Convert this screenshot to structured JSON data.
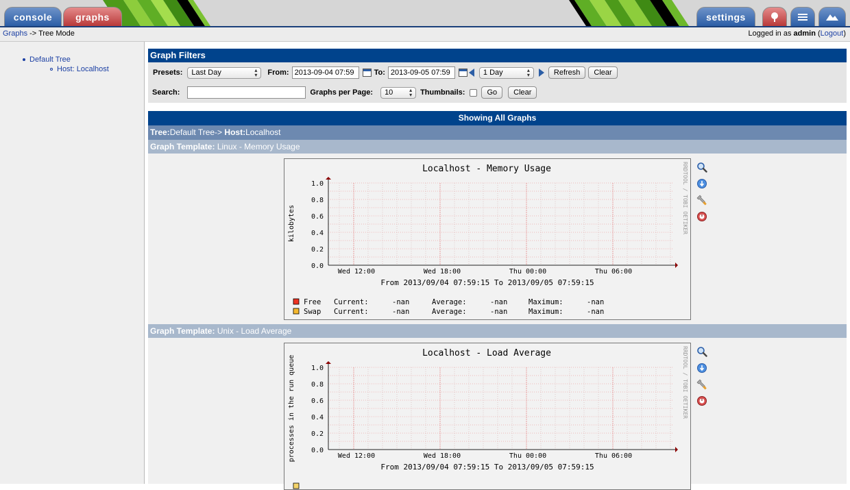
{
  "nav": {
    "console_label": "console",
    "graphs_label": "graphs",
    "settings_label": "settings"
  },
  "breadcrumb": {
    "graphs_link": "Graphs",
    "rest": " -> Tree Mode"
  },
  "login": {
    "prefix": "Logged in as ",
    "user": "admin",
    "logout": "Logout"
  },
  "tree": {
    "root": "Default Tree",
    "host": "Host: Localhost"
  },
  "filters": {
    "title": "Graph Filters",
    "presets_label": "Presets:",
    "presets_value": "Last Day",
    "from_label": "From:",
    "from_value": "2013-09-04 07:59",
    "to_label": "To:",
    "to_value": "2013-09-05 07:59",
    "timespan_value": "1 Day",
    "refresh_label": "Refresh",
    "clear_label": "Clear",
    "search_label": "Search:",
    "search_value": "",
    "per_page_label": "Graphs per Page:",
    "per_page_value": "10",
    "thumbnails_label": "Thumbnails:",
    "go_label": "Go",
    "clear2_label": "Clear"
  },
  "showing": "Showing All Graphs",
  "tree_header": {
    "tree_label": "Tree:",
    "tree_value": "Default Tree->",
    "host_label": "Host:",
    "host_value": "Localhost"
  },
  "graphs": [
    {
      "template_label": "Graph Template:",
      "template_value": "Linux - Memory Usage",
      "title": "Localhost - Memory Usage",
      "ylabel": "kilobytes",
      "yticks": [
        "1.0",
        "0.8",
        "0.6",
        "0.4",
        "0.2",
        "0.0"
      ],
      "xticks": [
        "Wed 12:00",
        "Wed 18:00",
        "Thu 00:00",
        "Thu 06:00"
      ],
      "range": "From 2013/09/04 07:59:15 To 2013/09/05 07:59:15",
      "watermark": "RRDTOOL / TOBI OETIKER",
      "legend": [
        {
          "name": "Free",
          "color": "#ee3322",
          "current": "Current:",
          "cur_val": "-nan",
          "average": "Average:",
          "avg_val": "-nan",
          "maximum": "Maximum:",
          "max_val": "-nan"
        },
        {
          "name": "Swap",
          "color": "#f5b82e",
          "current": "Current:",
          "cur_val": "-nan",
          "average": "Average:",
          "avg_val": "-nan",
          "maximum": "Maximum:",
          "max_val": "-nan"
        }
      ]
    },
    {
      "template_label": "Graph Template:",
      "template_value": "Unix - Load Average",
      "title": "Localhost - Load Average",
      "ylabel": "processes in the run queue",
      "yticks": [
        "1.0",
        "0.8",
        "0.6",
        "0.4",
        "0.2",
        "0.0"
      ],
      "xticks": [
        "Wed 12:00",
        "Wed 18:00",
        "Thu 00:00",
        "Thu 06:00"
      ],
      "range": "From 2013/09/04 07:59:15 To 2013/09/05 07:59:15",
      "watermark": "RRDTOOL / TOBI OETIKER",
      "legend": []
    }
  ],
  "icons": [
    "zoom-icon",
    "csv-export-icon",
    "edit-graph-icon",
    "debug-icon"
  ],
  "colors": {
    "header_blue": "#00438c",
    "tree_bar": "#6d89b0",
    "template_bar": "#a8b8cc"
  }
}
